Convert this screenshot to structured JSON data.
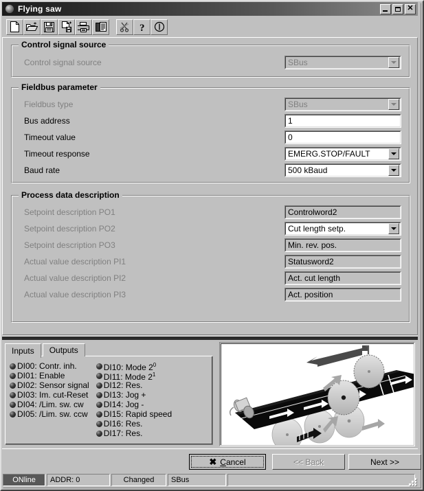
{
  "window": {
    "title": "Flying saw",
    "icon": "app-icon",
    "buttons": {
      "minimize": "minimize-icon",
      "maximize": "maximize-icon",
      "close": "close-icon"
    }
  },
  "toolbar": {
    "items": [
      {
        "name": "new-file-icon",
        "tooltip": "New"
      },
      {
        "name": "open-folder-icon",
        "tooltip": "Open"
      },
      {
        "name": "save-disk-icon",
        "tooltip": "Save"
      },
      {
        "name": "save-as-icon",
        "tooltip": "Save as"
      },
      {
        "name": "print-icon",
        "tooltip": "Print"
      },
      {
        "name": "report-icon",
        "tooltip": "Report"
      },
      {
        "name": "cut-disabled-icon",
        "tooltip": "Cut"
      },
      {
        "name": "help-question-icon",
        "tooltip": "Help"
      },
      {
        "name": "info-icon",
        "tooltip": "Info"
      }
    ]
  },
  "groups": {
    "control_signal_source": {
      "title": "Control signal source",
      "fields": [
        {
          "label": "Control signal source",
          "value": "SBus",
          "control": "combobox",
          "disabled": true
        }
      ]
    },
    "fieldbus_parameter": {
      "title": "Fieldbus parameter",
      "fields": [
        {
          "label": "Fieldbus type",
          "value": "SBus",
          "control": "combobox",
          "disabled": true
        },
        {
          "label": "Bus address",
          "value": "1",
          "control": "textbox",
          "disabled": false
        },
        {
          "label": "Timeout value",
          "value": "0",
          "control": "textbox",
          "disabled": false
        },
        {
          "label": "Timeout response",
          "value": "EMERG.STOP/FAULT",
          "control": "combobox",
          "disabled": false
        },
        {
          "label": "Baud rate",
          "value": "500 kBaud",
          "control": "combobox",
          "disabled": false
        }
      ]
    },
    "process_data_description": {
      "title": "Process data description",
      "fields": [
        {
          "label": "Setpoint description PO1",
          "value": "Controlword2",
          "control": "readonly",
          "disabled": false
        },
        {
          "label": "Setpoint description PO2",
          "value": "Cut length setp.",
          "control": "combobox",
          "disabled": false
        },
        {
          "label": "Setpoint description PO3",
          "value": "Min. rev. pos.",
          "control": "readonly",
          "disabled": false
        },
        {
          "label": "Actual value description PI1",
          "value": "Statusword2",
          "control": "readonly",
          "disabled": false
        },
        {
          "label": "Actual value description PI2",
          "value": "Act. cut length",
          "control": "readonly",
          "disabled": false
        },
        {
          "label": "Actual value description PI3",
          "value": "Act. position",
          "control": "readonly",
          "disabled": false
        }
      ]
    }
  },
  "io_panel": {
    "tabs": [
      {
        "label": "Inputs",
        "active": true
      },
      {
        "label": "Outputs",
        "active": false
      }
    ],
    "columns": [
      [
        {
          "id": "DI00",
          "text": "DI00: Contr. inh."
        },
        {
          "id": "DI01",
          "text": "DI01: Enable"
        },
        {
          "id": "DI02",
          "text": "DI02: Sensor signal"
        },
        {
          "id": "DI03",
          "text": "DI03: Im. cut-Reset"
        },
        {
          "id": "DI04",
          "text": "DI04: /Lim. sw. cw"
        },
        {
          "id": "DI05",
          "text": "DI05: /Lim. sw. ccw"
        }
      ],
      [
        {
          "id": "DI10",
          "text": "DI10: Mode 2",
          "sup": "0"
        },
        {
          "id": "DI11",
          "text": "DI11: Mode 2",
          "sup": "1"
        },
        {
          "id": "DI12",
          "text": "DI12: Res."
        },
        {
          "id": "DI13",
          "text": "DI13: Jog +"
        },
        {
          "id": "DI14",
          "text": "DI14: Jog -"
        },
        {
          "id": "DI15",
          "text": "DI15: Rapid speed"
        },
        {
          "id": "DI16",
          "text": "DI16: Res."
        },
        {
          "id": "DI17",
          "text": "DI17: Res."
        }
      ]
    ]
  },
  "illustration": {
    "name": "flying-saw-diagram",
    "description": "Conveyor belt with circular saw blades and motion arrows"
  },
  "dialog_buttons": {
    "cancel": "Cancel",
    "cancel_accel": "C",
    "back": "<< Back",
    "back_disabled": true,
    "next": "Next >>",
    "next_disabled": false
  },
  "statusbar": {
    "connection": "ONline",
    "address": "ADDR: 0",
    "state": "Changed",
    "bus": "SBus"
  },
  "colors": {
    "face": "#c0c0c0",
    "shadow": "#808080",
    "dark": "#404040",
    "light": "#ffffff",
    "disabled_text": "#808080",
    "title_start": "#1b1b1b",
    "title_end": "#8d8d8d",
    "status_highlight": "#585858"
  }
}
